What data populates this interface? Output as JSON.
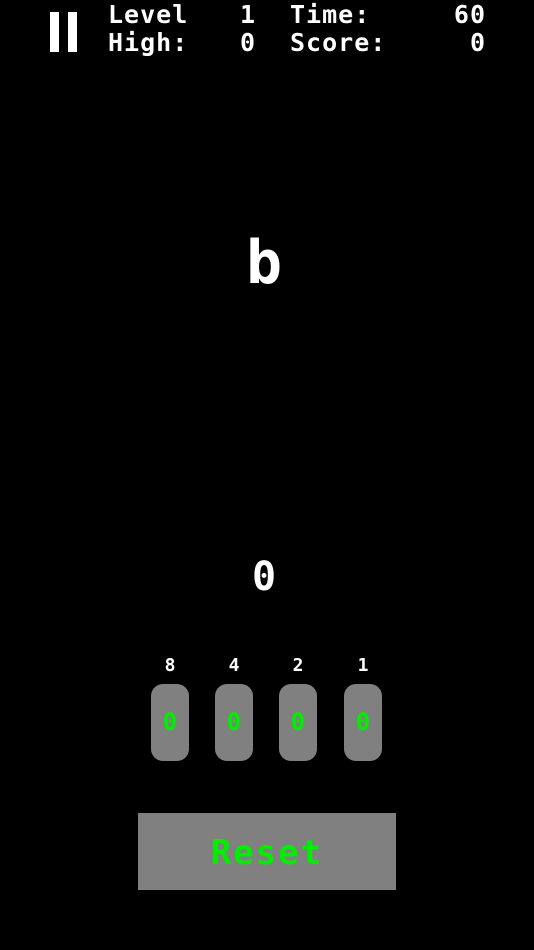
{
  "hud": {
    "level_label": "Level",
    "level_value": "1",
    "time_label": "Time:",
    "time_value": "60",
    "high_label": "High:",
    "high_value": "0",
    "score_label": "Score:",
    "score_value": "0"
  },
  "pause": {
    "icon": "pause-icon"
  },
  "game": {
    "target_char": "b",
    "current_value": "0"
  },
  "bits": [
    {
      "weight": "8",
      "value": "0"
    },
    {
      "weight": "4",
      "value": "0"
    },
    {
      "weight": "2",
      "value": "0"
    },
    {
      "weight": "1",
      "value": "0"
    }
  ],
  "reset": {
    "label": "Reset"
  },
  "colors": {
    "background": "#000000",
    "text": "#ffffff",
    "button_bg": "#808080",
    "button_text": "#00ee00"
  }
}
